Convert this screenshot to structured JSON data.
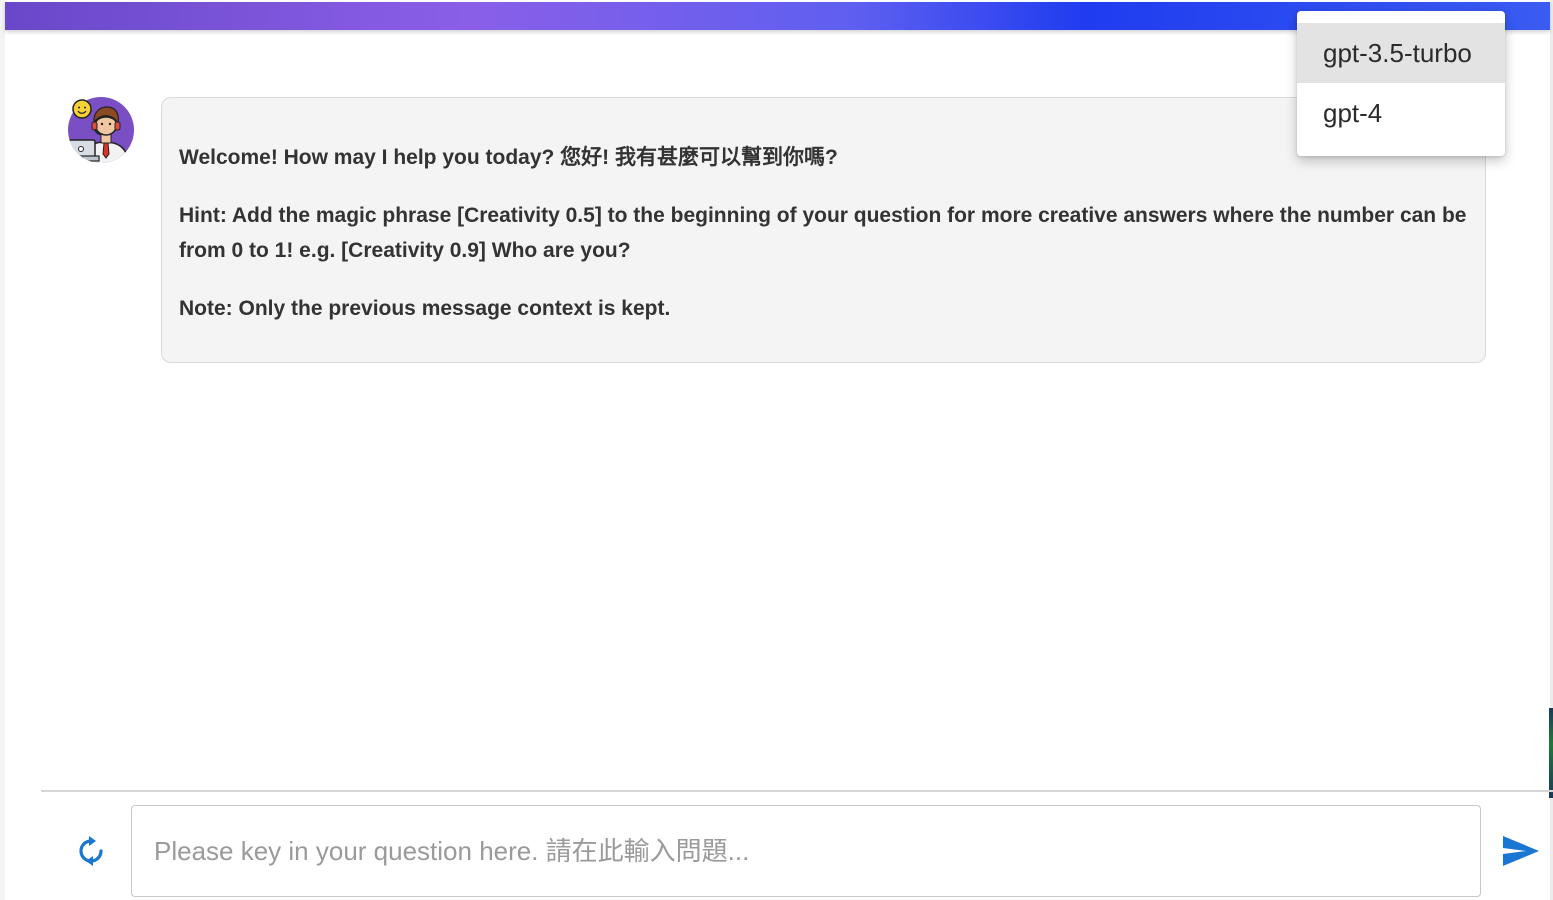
{
  "model_menu": {
    "options": [
      "gpt-3.5-turbo",
      "gpt-4"
    ],
    "selected": "gpt-3.5-turbo"
  },
  "chat": {
    "messages": [
      {
        "role": "assistant",
        "avatar_icon": "support-agent-avatar",
        "paragraphs": [
          "Welcome! How may I help you today? 您好! 我有甚麼可以幫到你嗎?",
          "Hint: Add the magic phrase [Creativity 0.5] to the beginning of your question for more creative answers where the number can be from 0 to 1! e.g. [Creativity 0.9] Who are you?",
          "Note: Only the previous message context is kept."
        ]
      }
    ]
  },
  "composer": {
    "placeholder": "Please key in your question here. 請在此輸入問題...",
    "value": "",
    "reset_icon": "refresh-icon",
    "send_icon": "send-icon"
  },
  "colors": {
    "header_gradient_start": "#6a47c9",
    "header_gradient_end": "#1f3cf0",
    "bubble_background": "#f4f4f4",
    "accent_blue": "#1976d2",
    "selected_option_bg": "#e3e3e3"
  }
}
